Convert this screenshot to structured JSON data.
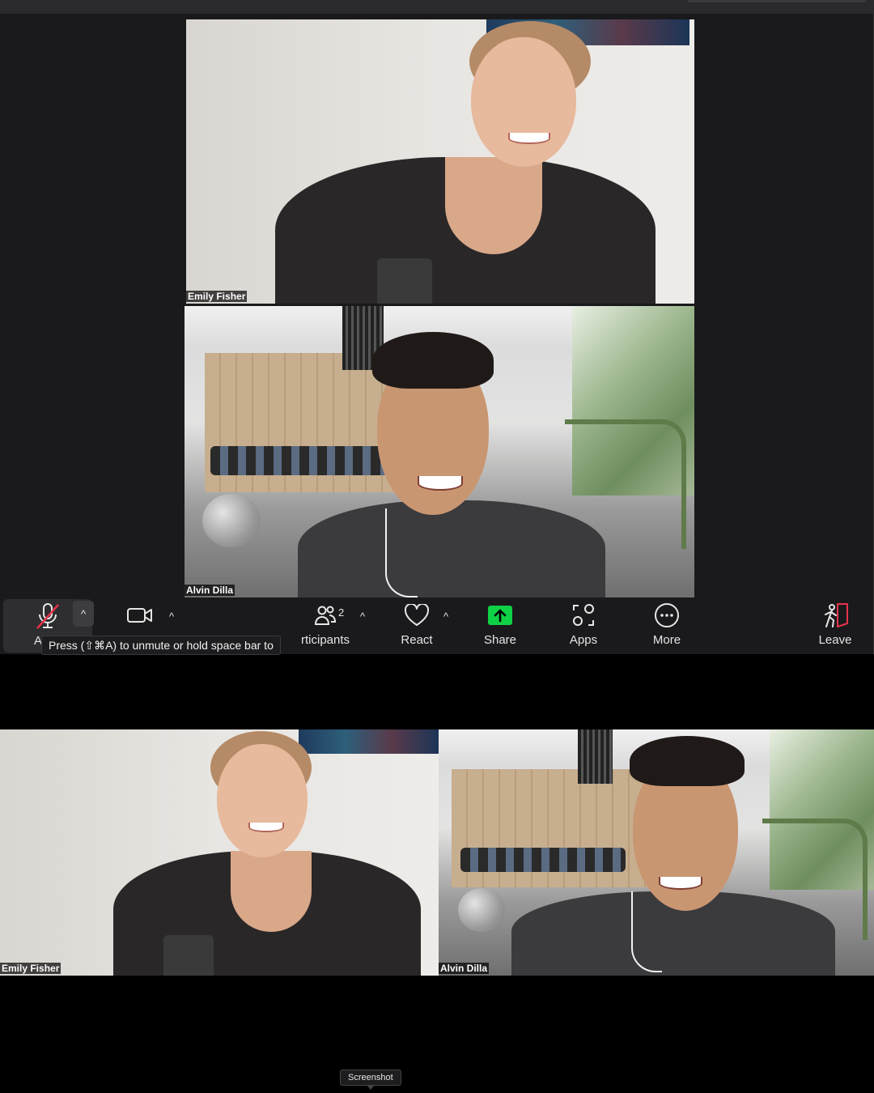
{
  "meeting": {
    "participants": [
      {
        "name": "Emily Fisher"
      },
      {
        "name": "Alvin Dilla"
      }
    ]
  },
  "toolbar": {
    "audio_label": "Au",
    "audio_muted": true,
    "video_label": "",
    "participants_count": "2",
    "participants_label": "rticipants",
    "react_label": "React",
    "share_label": "Share",
    "apps_label": "Apps",
    "more_label": "More",
    "leave_label": "Leave",
    "caret": "^"
  },
  "tooltip": {
    "text": "Press  (⇧⌘A) to unmute or hold space bar to"
  },
  "screenshot_tip": {
    "text": "Screenshot"
  },
  "colors": {
    "share_green": "#0ed145",
    "muted_red": "#e5334a",
    "leave_red": "#e5334a",
    "toolbar_bg": "#1a1a1c"
  },
  "icons": [
    "microphone-muted-icon",
    "video-camera-icon",
    "participants-icon",
    "heart-icon",
    "share-arrow-icon",
    "apps-icon",
    "more-dots-icon",
    "leave-icon"
  ]
}
